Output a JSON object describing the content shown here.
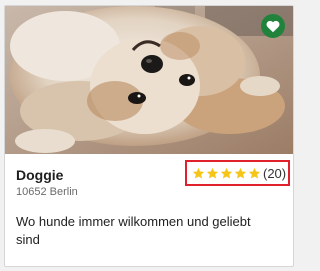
{
  "listing": {
    "name": "Doggie",
    "address": "10652 Berlin",
    "description": "Wo hunde immer wilkommen und geliebt sind",
    "rating_stars": 5,
    "review_count_label": "(20)"
  },
  "icons": {
    "favorite": "heart-icon",
    "rating": "star-icon"
  },
  "colors": {
    "favorite_badge": "#21833b",
    "star": "#f5c518",
    "rating_highlight_border": "#e0202a"
  }
}
